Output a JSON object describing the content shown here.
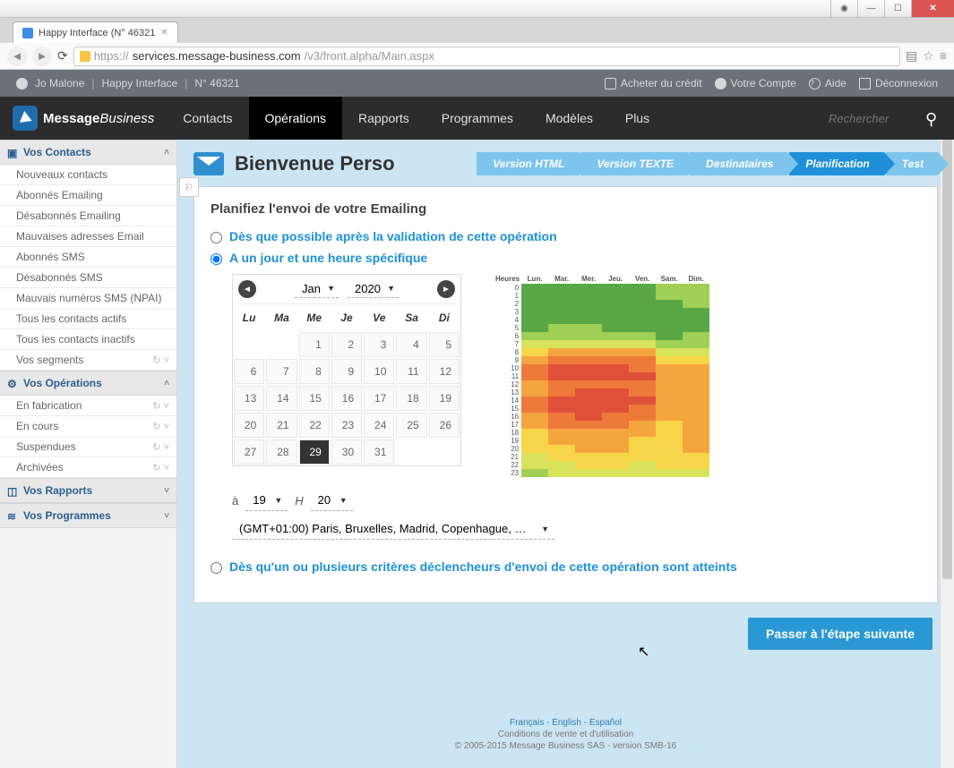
{
  "window": {
    "title": "Happy Interface (N° 46321"
  },
  "url": {
    "scheme": "https://",
    "host": "services.message-business.com",
    "path": "/v3/front.alpha/Main.aspx"
  },
  "utility": {
    "user": "Jo Malone",
    "account": "Happy Interface",
    "number": "N° 46321",
    "credit": "Acheter du crédit",
    "compte": "Votre Compte",
    "help": "Aide",
    "logout": "Déconnexion"
  },
  "brand": {
    "a": "Message",
    "b": "Business"
  },
  "nav": {
    "items": [
      "Contacts",
      "Opérations",
      "Rapports",
      "Programmes",
      "Modèles",
      "Plus"
    ],
    "active": 1,
    "search_placeholder": "Rechercher"
  },
  "sidebar": {
    "groups": [
      {
        "title": "Vos Contacts",
        "items": [
          "Nouveaux contacts",
          "Abonnés Emailing",
          "Désabonnés Emailing",
          "Mauvaises adresses Email",
          "Abonnés SMS",
          "Désabonnés SMS",
          "Mauvais numéros SMS (NPAI)",
          "Tous les contacts actifs",
          "Tous les contacts inactifs",
          "Vos segments"
        ]
      },
      {
        "title": "Vos Opérations",
        "items": [
          "En fabrication",
          "En cours",
          "Suspendues",
          "Archivées"
        ]
      },
      {
        "title": "Vos Rapports",
        "items": []
      },
      {
        "title": "Vos Programmes",
        "items": []
      }
    ]
  },
  "page_title": "Bienvenue Perso",
  "steps": {
    "items": [
      "Version HTML",
      "Version TEXTE",
      "Destinataires",
      "Planification",
      "Test"
    ],
    "active": 3
  },
  "panel": {
    "heading": "Planifiez l'envoi de votre Emailing",
    "opt_asap": "Dès que possible après la validation de cette opération",
    "opt_specific": "A un jour et une heure spécifique",
    "opt_trigger": "Dès qu'un ou plusieurs critères déclencheurs d'envoi de cette opération sont atteints",
    "selected": 1
  },
  "calendar": {
    "month": "Jan",
    "year": "2020",
    "dow": [
      "Lu",
      "Ma",
      "Me",
      "Je",
      "Ve",
      "Sa",
      "Di"
    ],
    "weeks": [
      [
        null,
        null,
        1,
        2,
        3,
        4,
        5
      ],
      [
        6,
        7,
        8,
        9,
        10,
        11,
        12
      ],
      [
        13,
        14,
        15,
        16,
        17,
        18,
        19
      ],
      [
        20,
        21,
        22,
        23,
        24,
        25,
        26
      ],
      [
        27,
        28,
        29,
        30,
        31,
        null,
        null
      ]
    ],
    "selected": 29
  },
  "time": {
    "at_label": "à",
    "hour": "19",
    "h_label": "H",
    "minute": "20"
  },
  "timezone": "(GMT+01:00) Paris, Bruxelles, Madrid, Copenhague, …",
  "next_label": "Passer à l'étape suivante",
  "footer": {
    "langs": "Français - English - Español",
    "terms": "Conditions de vente et d'utilisation",
    "copy": "© 2005-2015 Message Business SAS - version SMB-16"
  },
  "chart_data": {
    "type": "heatmap",
    "title": "Heures",
    "xlabels": [
      "Lun.",
      "Mar.",
      "Mer.",
      "Jeu.",
      "Ven.",
      "Sam.",
      "Dim."
    ],
    "ylabels": [
      0,
      1,
      2,
      3,
      4,
      5,
      6,
      7,
      8,
      9,
      10,
      11,
      12,
      13,
      14,
      15,
      16,
      17,
      18,
      19,
      20,
      21,
      22,
      23
    ],
    "values": [
      [
        1,
        1,
        1,
        1,
        1,
        2,
        2
      ],
      [
        1,
        1,
        1,
        1,
        1,
        2,
        2
      ],
      [
        1,
        1,
        1,
        1,
        1,
        1,
        2
      ],
      [
        1,
        1,
        1,
        1,
        1,
        1,
        1
      ],
      [
        1,
        1,
        1,
        1,
        1,
        1,
        1
      ],
      [
        1,
        2,
        2,
        1,
        1,
        1,
        1
      ],
      [
        2,
        2,
        2,
        2,
        2,
        1,
        2
      ],
      [
        3,
        3,
        3,
        3,
        3,
        2,
        2
      ],
      [
        4,
        5,
        5,
        5,
        5,
        3,
        3
      ],
      [
        5,
        6,
        6,
        6,
        6,
        4,
        4
      ],
      [
        6,
        7,
        7,
        7,
        6,
        5,
        5
      ],
      [
        6,
        7,
        7,
        7,
        7,
        5,
        5
      ],
      [
        5,
        6,
        6,
        6,
        6,
        5,
        5
      ],
      [
        5,
        6,
        7,
        7,
        6,
        5,
        5
      ],
      [
        6,
        7,
        7,
        7,
        7,
        5,
        5
      ],
      [
        6,
        7,
        7,
        7,
        6,
        5,
        5
      ],
      [
        5,
        6,
        7,
        6,
        6,
        5,
        5
      ],
      [
        5,
        6,
        6,
        6,
        5,
        4,
        5
      ],
      [
        4,
        5,
        5,
        5,
        5,
        4,
        5
      ],
      [
        4,
        5,
        5,
        5,
        4,
        4,
        5
      ],
      [
        4,
        4,
        5,
        5,
        4,
        4,
        5
      ],
      [
        3,
        4,
        4,
        4,
        4,
        4,
        4
      ],
      [
        3,
        3,
        4,
        4,
        3,
        4,
        4
      ],
      [
        2,
        3,
        3,
        3,
        3,
        3,
        3
      ]
    ],
    "colorscale": {
      "1": "#58a848",
      "2": "#9fcf54",
      "3": "#d8e25a",
      "4": "#f6d648",
      "5": "#f4a53e",
      "6": "#ed7a3a",
      "7": "#e0503a"
    }
  }
}
